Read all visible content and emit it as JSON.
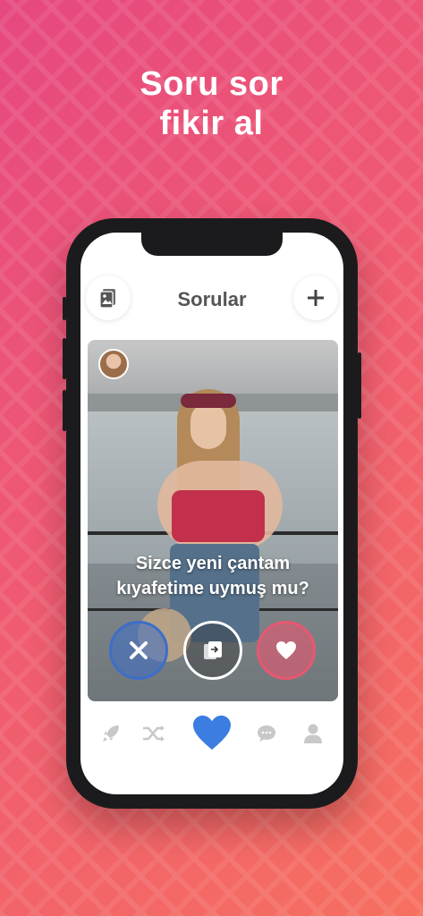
{
  "headline": {
    "line1": "Soru sor",
    "line2": "fikir al"
  },
  "app": {
    "header_title": "Sorular",
    "left_button_icon": "photo-stack-icon",
    "right_button_icon": "plus-icon",
    "question_text_line1": "Sizce yeni çantam",
    "question_text_line2": "kıyafetime uymuş mu?",
    "actions": [
      {
        "name": "dislike",
        "icon": "close-icon",
        "color": "#3d6ec8"
      },
      {
        "name": "skip",
        "icon": "skip-card-icon",
        "color": "#ffffff"
      },
      {
        "name": "like",
        "icon": "heart-icon",
        "color": "#e85770"
      }
    ],
    "bottom_nav": [
      {
        "icon": "rocket-icon",
        "active": false
      },
      {
        "icon": "shuffle-icon",
        "active": false
      },
      {
        "icon": "heart-icon",
        "active": true
      },
      {
        "icon": "chat-icon",
        "active": false
      },
      {
        "icon": "profile-icon",
        "active": false
      }
    ]
  },
  "colors": {
    "gradient_start": "#e64880",
    "gradient_end": "#f6705f",
    "nav_active": "#3b7de0",
    "nav_inactive": "#c8c8c8"
  }
}
